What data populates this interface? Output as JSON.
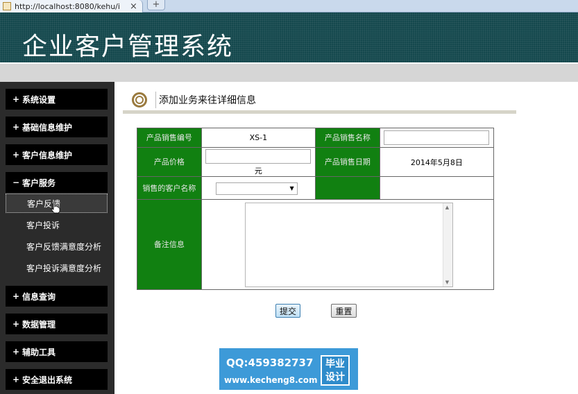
{
  "browser": {
    "tab_url": "http://localhost:8080/kehu/i",
    "close_glyph": "×",
    "new_tab_glyph": "+"
  },
  "banner": {
    "title": "企业客户管理系统"
  },
  "sidebar": {
    "items": [
      {
        "sign": "+",
        "label": "系统设置"
      },
      {
        "sign": "+",
        "label": "基础信息维护"
      },
      {
        "sign": "+",
        "label": "客户信息维护"
      },
      {
        "sign": "−",
        "label": "客户服务"
      },
      {
        "sign": "+",
        "label": "信息查询"
      },
      {
        "sign": "+",
        "label": "数据管理"
      },
      {
        "sign": "+",
        "label": "辅助工具"
      },
      {
        "sign": "+",
        "label": "安全退出系统"
      }
    ],
    "subitems": [
      {
        "label": "客户反馈",
        "active": true
      },
      {
        "label": "客户投诉",
        "active": false
      },
      {
        "label": "客户反馈满意度分析",
        "active": false
      },
      {
        "label": "客户投诉满意度分析",
        "active": false
      }
    ]
  },
  "main": {
    "title": "添加业务来往详细信息",
    "form": {
      "product_no_label": "产品销售编号",
      "product_no_value": "XS-1",
      "product_name_label": "产品销售名称",
      "product_name_value": "",
      "price_label": "产品价格",
      "price_value": "",
      "price_unit": "元",
      "date_label": "产品销售日期",
      "date_value": "2014年5月8日",
      "customer_label": "销售的客户名称",
      "customer_value": "",
      "notes_label": "备注信息",
      "notes_value": ""
    },
    "buttons": {
      "submit": "提交",
      "reset": "重置"
    }
  },
  "promo": {
    "qq": "QQ:459382737",
    "site": "www.kecheng8.com",
    "badge_line1": "毕业",
    "badge_line2": "设计"
  },
  "colors": {
    "banner_bg": "#14484d",
    "sidebar_bg": "#2b2b2b",
    "label_green": "#118011",
    "promo_blue": "#3d9ad8"
  }
}
